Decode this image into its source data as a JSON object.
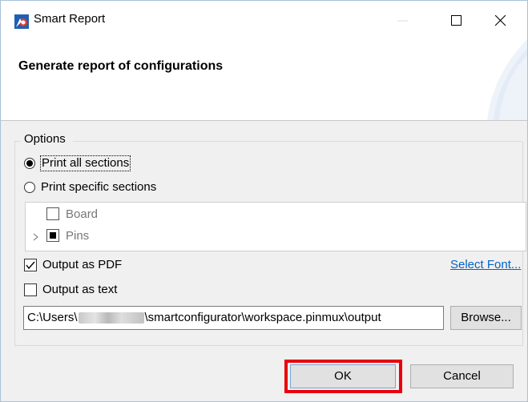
{
  "window": {
    "title": "Smart Report",
    "app_icon": "smart-configurator-icon",
    "controls": [
      "minimize-icon",
      "maximize-icon",
      "close-icon"
    ]
  },
  "banner": {
    "title": "Generate report of configurations"
  },
  "options": {
    "group_label": "Options",
    "print_all_label": "Print all sections",
    "print_specific_label": "Print specific sections",
    "selected": "Print all sections",
    "tree": [
      {
        "label": "Board",
        "checked": false,
        "expandable": false
      },
      {
        "label": "Pins",
        "checked": "partial",
        "expandable": true
      }
    ],
    "output_pdf_label": "Output as PDF",
    "output_pdf_checked": true,
    "output_text_label": "Output as text",
    "output_text_checked": false,
    "select_font_label": "Select Font...",
    "path_prefix": "C:\\Users\\",
    "path_suffix": "\\smartconfigurator\\workspace.pinmux\\output",
    "browse_label": "Browse..."
  },
  "footer": {
    "ok_label": "OK",
    "cancel_label": "Cancel",
    "highlight_color": "#e8000e"
  }
}
